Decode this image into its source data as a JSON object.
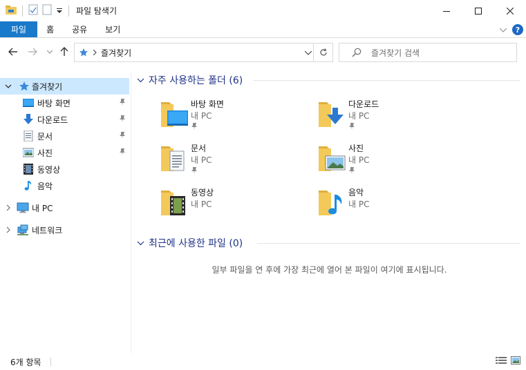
{
  "window": {
    "title": "파일 탐색기"
  },
  "ribbon": {
    "tabs": [
      {
        "label": "파일"
      },
      {
        "label": "홈"
      },
      {
        "label": "공유"
      },
      {
        "label": "보기"
      }
    ]
  },
  "address": {
    "path": "즐겨찾기",
    "search_placeholder": "즐겨찾기 검색"
  },
  "sidebar": {
    "quick_access": "즐겨찾기",
    "pinned": [
      {
        "label": "바탕 화면",
        "icon": "desktop-icon",
        "pinned": true
      },
      {
        "label": "다운로드",
        "icon": "download-icon",
        "pinned": true
      },
      {
        "label": "문서",
        "icon": "document-icon",
        "pinned": true
      },
      {
        "label": "사진",
        "icon": "pictures-icon",
        "pinned": true
      },
      {
        "label": "동영상",
        "icon": "video-icon",
        "pinned": false
      },
      {
        "label": "음악",
        "icon": "music-icon",
        "pinned": false
      }
    ],
    "this_pc": "내 PC",
    "network": "네트워크"
  },
  "main": {
    "frequent_header": "자주 사용하는 폴더 (6)",
    "folders": [
      {
        "name": "바탕 화면",
        "location": "내 PC",
        "pinned": true,
        "icon": "desktop-icon"
      },
      {
        "name": "다운로드",
        "location": "내 PC",
        "pinned": true,
        "icon": "download-icon"
      },
      {
        "name": "문서",
        "location": "내 PC",
        "pinned": true,
        "icon": "document-icon"
      },
      {
        "name": "사진",
        "location": "내 PC",
        "pinned": true,
        "icon": "pictures-icon"
      },
      {
        "name": "동영상",
        "location": "내 PC",
        "pinned": false,
        "icon": "video-icon"
      },
      {
        "name": "음악",
        "location": "내 PC",
        "pinned": false,
        "icon": "music-icon"
      }
    ],
    "recent_header": "최근에 사용한 파일 (0)",
    "recent_empty": "일부 파일을 연 후에 가장 최근에 열어 본 파일이 여기에 표시됩니다."
  },
  "status": {
    "item_count": "6개 항목"
  },
  "colors": {
    "accent": "#1979ca",
    "selection": "#cce8ff",
    "group_header": "#1e3287",
    "folder": "#f3c95a"
  }
}
